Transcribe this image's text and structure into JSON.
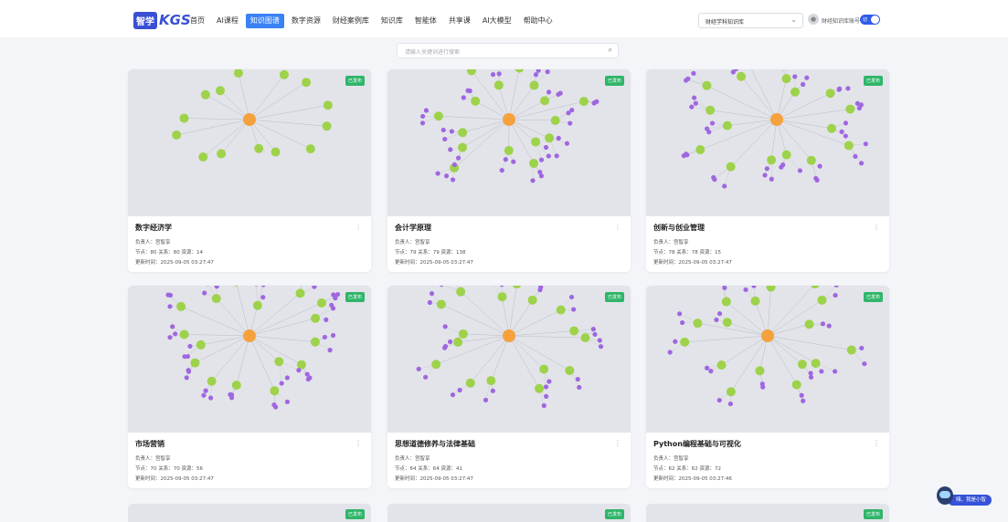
{
  "header": {
    "logo_mark": "智学",
    "logo_text": "KGS",
    "nav": [
      "首页",
      "AI课程",
      "知识图谱",
      "数字资源",
      "财经案例库",
      "知识库",
      "智能体",
      "共享课",
      "AI大模型",
      "帮助中心"
    ],
    "active_nav": 2,
    "kb_select": "财经学科知识库",
    "user_name": "财经知识库账号",
    "toggle_label": "切"
  },
  "search": {
    "placeholder": "请输入关键词进行搜索"
  },
  "status_label": "已发布",
  "owner_label": "负责人：",
  "cards": [
    {
      "title": "数字经济学",
      "owner": "宫智享",
      "stats": "节点：80  关系：80  资源：14",
      "updated": "更新时间：2025-09-05 03:27:47"
    },
    {
      "title": "会计学原理",
      "owner": "宫智享",
      "stats": "节点：79  关系：79  资源：138",
      "updated": "更新时间：2025-09-05 03:27:47"
    },
    {
      "title": "创新与创业管理",
      "owner": "宫智享",
      "stats": "节点：78  关系：78  资源：15",
      "updated": "更新时间：2025-09-05 03:27:47"
    },
    {
      "title": "市场营销",
      "owner": "宫智享",
      "stats": "节点：70  关系：70  资源：56",
      "updated": "更新时间：2025-09-05 03:27:47"
    },
    {
      "title": "思想道德修养与法律基础",
      "owner": "宫智享",
      "stats": "节点：64  关系：64  资源：41",
      "updated": "更新时间：2025-09-05 03:27:47"
    },
    {
      "title": "Python编程基础与可视化",
      "owner": "宫智享",
      "stats": "节点：62  关系：62  资源：72",
      "updated": "更新时间：2025-09-05 03:27:46"
    }
  ],
  "assistant": {
    "label": "嗨，我是小智"
  },
  "colors": {
    "primary": "#3b82f6",
    "center_node": "#f6a13c",
    "green_node": "#9ed24a",
    "purple_node": "#a066e0",
    "badge": "#30b56a"
  },
  "icons": {
    "search": "search-icon",
    "chevron": "chevron-down-icon",
    "more": "more-vertical-icon"
  }
}
